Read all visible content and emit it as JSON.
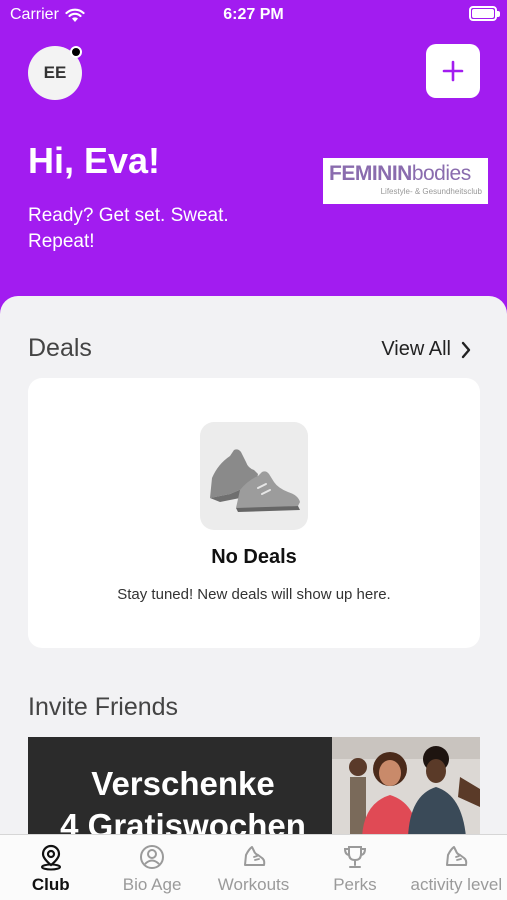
{
  "status_bar": {
    "carrier": "Carrier",
    "time": "6:27 PM",
    "icons": [
      "wifi-icon",
      "battery-icon"
    ]
  },
  "header": {
    "avatar_initials": "EE",
    "add_button_icon": "plus-icon",
    "greeting": "Hi, Eva!",
    "subtitle": "Ready? Get set. Sweat. Repeat!",
    "brand_logo": {
      "main_bold": "FEMININ",
      "main_light": "bodies",
      "tagline": "Lifestyle- & Gesundheitsclub"
    }
  },
  "deals": {
    "title": "Deals",
    "view_all": "View All",
    "empty_title": "No Deals",
    "empty_text": "Stay tuned! New deals will show up here."
  },
  "invite": {
    "title": "Invite Friends",
    "banner_line1": "Verschenke",
    "banner_line2": "4 Gratiswochen"
  },
  "tabs": [
    {
      "label": "Club",
      "icon": "location-pin-icon",
      "active": true
    },
    {
      "label": "Bio Age",
      "icon": "profile-icon",
      "active": false
    },
    {
      "label": "Workouts",
      "icon": "sneaker-icon",
      "active": false
    },
    {
      "label": "Perks",
      "icon": "trophy-icon",
      "active": false
    },
    {
      "label": "activity level",
      "icon": "sneaker-icon",
      "active": false
    }
  ],
  "colors": {
    "brand_purple": "#a21cf0",
    "background": "#f2f2f4",
    "card": "#ffffff"
  }
}
